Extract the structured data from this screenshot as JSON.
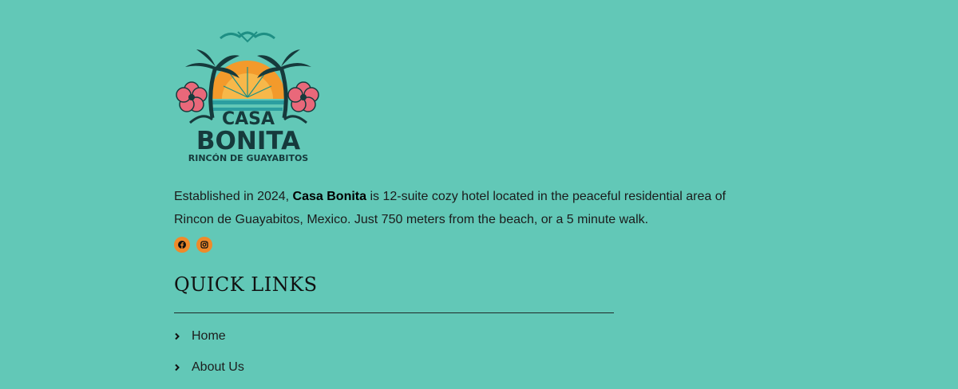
{
  "brand": {
    "logo_line1": "CASA",
    "logo_line2": "BONITA",
    "logo_line3": "RINCÓN DE GUAYABITOS"
  },
  "about": {
    "part1": "Established in 2024, ",
    "name": "Casa Bonita",
    "part2": " is 12-suite cozy hotel located in the peaceful residential area of Rincon de Guayabitos, Mexico. Just 750 meters from the beach, or a 5 minute walk."
  },
  "social": [
    {
      "icon": "facebook-icon"
    },
    {
      "icon": "instagram-icon"
    }
  ],
  "quick_links": {
    "title": "QUICK LINKS",
    "items": [
      {
        "label": "Home"
      },
      {
        "label": "About Us"
      }
    ]
  },
  "colors": {
    "background": "#62c8b7",
    "accent": "#ef8a2a",
    "logo_dark": "#163a3c"
  }
}
